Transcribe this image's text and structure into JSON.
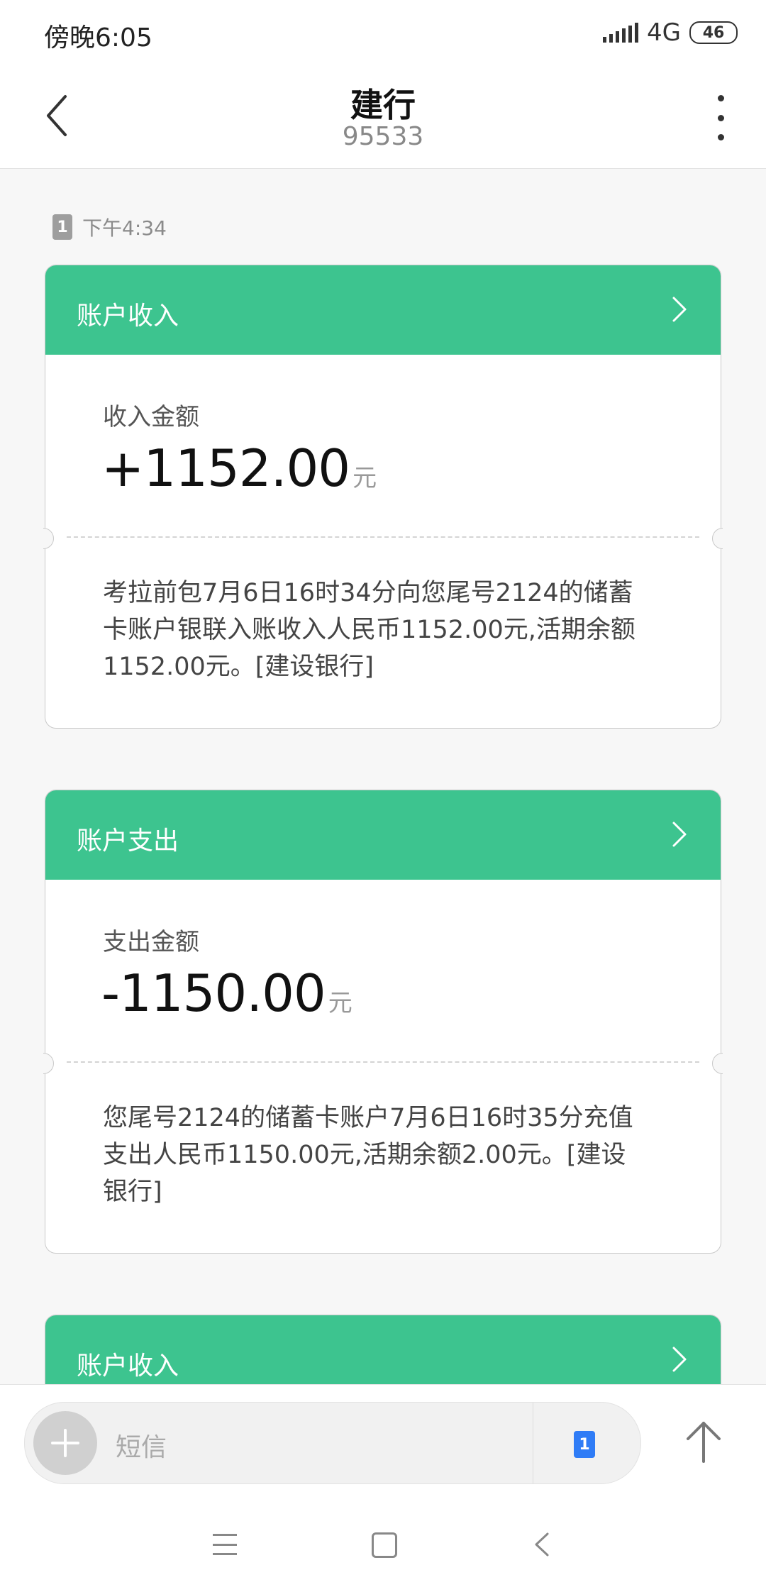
{
  "status_bar": {
    "time": "傍晚6:05",
    "network": "4G",
    "battery": "46"
  },
  "header": {
    "title": "建行",
    "subtitle": "95533"
  },
  "conversation": {
    "sim_slot": "1",
    "timestamp": "下午4:34"
  },
  "cards": [
    {
      "header_label": "账户收入",
      "amount_label": "收入金额",
      "amount": "+1152.00",
      "unit": "元",
      "body": "考拉前包7月6日16时34分向您尾号2124的储蓄卡账户银联入账收入人民币1152.00元,活期余额1152.00元。[建设银行]"
    },
    {
      "header_label": "账户支出",
      "amount_label": "支出金额",
      "amount": "-1150.00",
      "unit": "元",
      "body": "您尾号2124的储蓄卡账户7月6日16时35分充值支出人民币1150.00元,活期余额2.00元。[建设银行]"
    },
    {
      "header_label": "账户收入"
    }
  ],
  "input_bar": {
    "placeholder": "短信",
    "sim_slot": "1"
  },
  "colors": {
    "accent_green": "#3dc48f",
    "sim_blue": "#2f7cf6"
  }
}
